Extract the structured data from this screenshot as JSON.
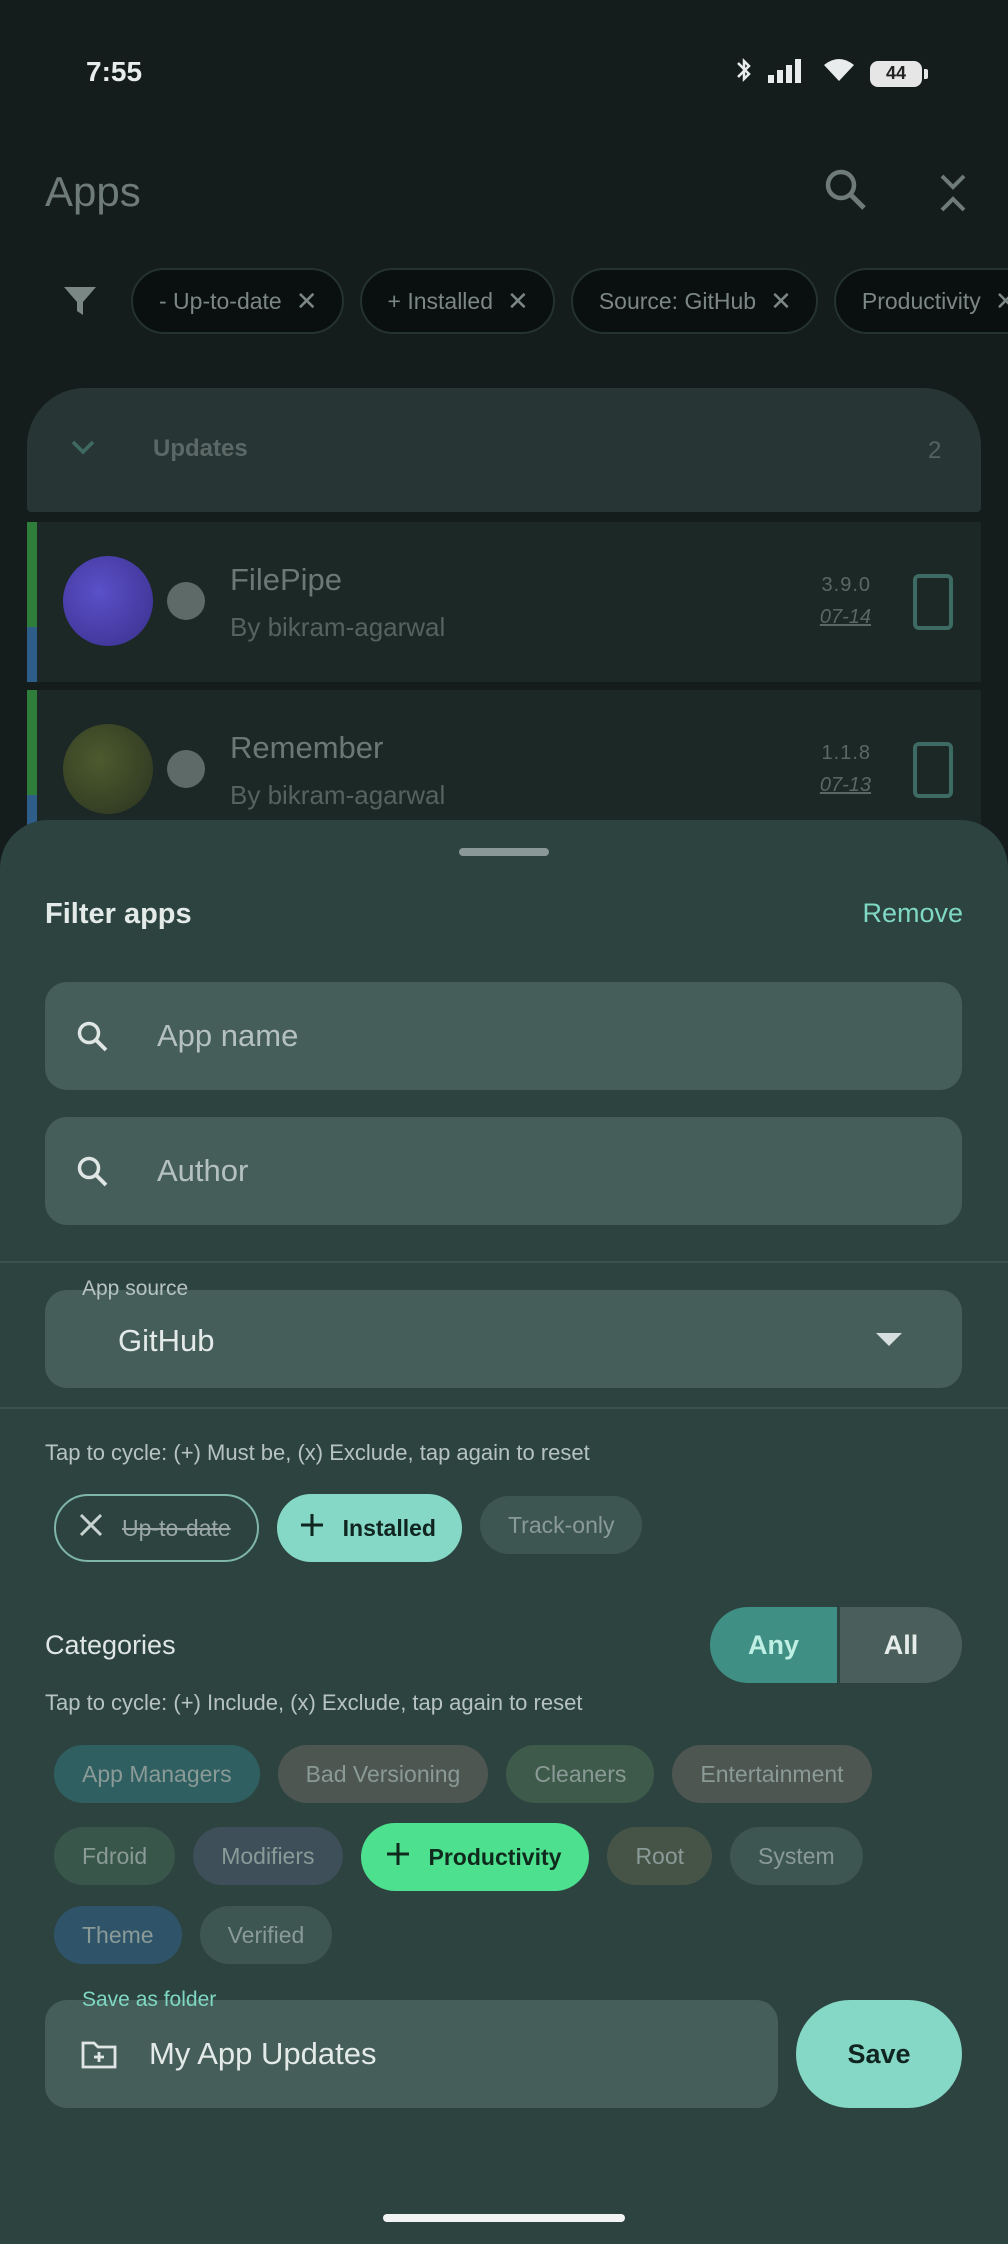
{
  "status_bar": {
    "time": "7:55",
    "battery": "44"
  },
  "app_bar": {
    "title": "Apps"
  },
  "active_filters": [
    {
      "label": "- Up-to-date"
    },
    {
      "label": "+ Installed"
    },
    {
      "label": "Source: GitHub"
    },
    {
      "label": "Productivity"
    }
  ],
  "list": {
    "section": {
      "label": "Updates",
      "count": "2"
    },
    "apps": [
      {
        "name": "FilePipe",
        "author": "By bikram-agarwal",
        "version": "3.9.0",
        "date": "07-14"
      },
      {
        "name": "Remember",
        "author": "By bikram-agarwal",
        "version": "1.1.8",
        "date": "07-13"
      }
    ]
  },
  "sheet": {
    "title": "Filter apps",
    "remove_label": "Remove",
    "app_name_placeholder": "App name",
    "author_placeholder": "Author",
    "app_source": {
      "label": "App source",
      "value": "GitHub"
    },
    "status_hint": "Tap to cycle: (+) Must be, (x) Exclude, tap again to reset",
    "status_chips": [
      {
        "label": "Up-to-date",
        "state": "exclude"
      },
      {
        "label": "Installed",
        "state": "include"
      },
      {
        "label": "Track-only",
        "state": "neutral"
      }
    ],
    "categories_label": "Categories",
    "match_toggle": {
      "any": "Any",
      "all": "All",
      "selected": "Any"
    },
    "categories_hint": "Tap to cycle: (+) Include, (x) Exclude, tap again to reset",
    "categories": [
      {
        "label": "App Managers",
        "color": "#2f5f60"
      },
      {
        "label": "Bad Versioning",
        "color": "#4e5652"
      },
      {
        "label": "Cleaners",
        "color": "#3e5a4a"
      },
      {
        "label": "Entertainment",
        "color": "#4e5652"
      },
      {
        "label": "Fdroid",
        "color": "#38574a"
      },
      {
        "label": "Modifiers",
        "color": "#3f4f5a"
      },
      {
        "label": "Productivity",
        "color": "#4de08f",
        "state": "include"
      },
      {
        "label": "Root",
        "color": "#465448"
      },
      {
        "label": "System",
        "color": "#3d5652"
      },
      {
        "label": "Theme",
        "color": "#2f546a"
      },
      {
        "label": "Verified",
        "color": "#3d5652"
      }
    ],
    "folder": {
      "label": "Save as folder",
      "value": "My App Updates",
      "save_label": "Save"
    }
  }
}
